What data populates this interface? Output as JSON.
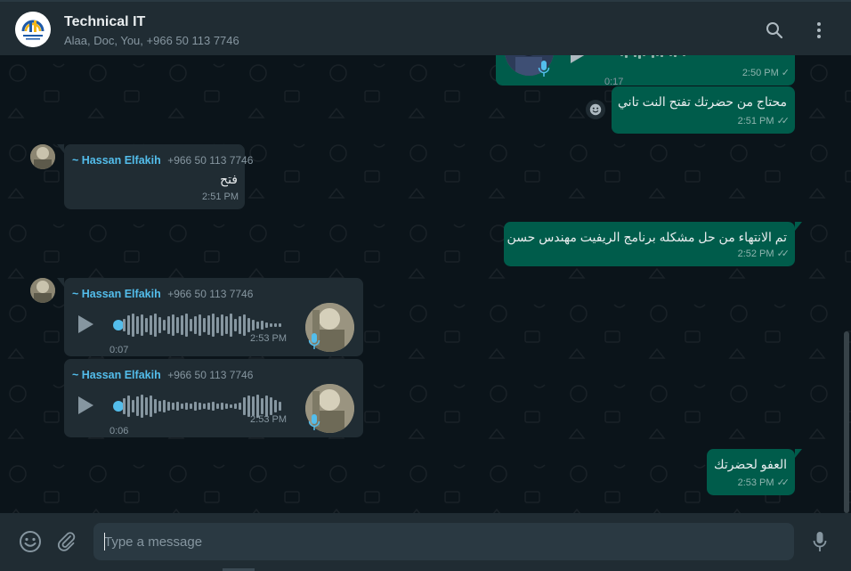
{
  "header": {
    "title": "Technical IT",
    "participants": "Alaa, Doc, You, +966 50 113 7746"
  },
  "messages": {
    "m0": {
      "duration": "0:17",
      "time": "2:50 PM"
    },
    "m1": {
      "text": "محتاج من حضرتك تفتح النت تاني",
      "time": "2:51 PM"
    },
    "m2": {
      "sender": "~ Hassan Elfakih",
      "phone": "+966 50 113 7746",
      "text": "فتح",
      "time": "2:51 PM"
    },
    "m3": {
      "text": "تم الانتهاء من حل مشكله برنامج الريفيت مهندس حسن",
      "time": "2:52 PM"
    },
    "m4": {
      "sender": "~ Hassan Elfakih",
      "phone": "+966 50 113 7746",
      "duration": "0:07",
      "time": "2:53 PM"
    },
    "m5": {
      "sender": "~ Hassan Elfakih",
      "phone": "+966 50 113 7746",
      "duration": "0:06",
      "time": "2:53 PM"
    },
    "m6": {
      "text": "العفو لحضرتك",
      "time": "2:53 PM"
    }
  },
  "composer": {
    "placeholder": "Type a message"
  },
  "icons": {
    "search": "search-icon",
    "menu": "kebab-menu-icon",
    "emoji": "emoji-icon",
    "attach": "paperclip-icon",
    "mic": "microphone-icon",
    "play": "play-icon",
    "read": "double-check-icon",
    "sent": "single-check-icon"
  },
  "colors": {
    "header_bg": "#202c33",
    "chat_bg": "#0b141a",
    "outgoing_bubble": "#005c4b",
    "incoming_bubble": "#202c33",
    "sender_name": "#53bdeb",
    "accent": "#53bdeb"
  }
}
